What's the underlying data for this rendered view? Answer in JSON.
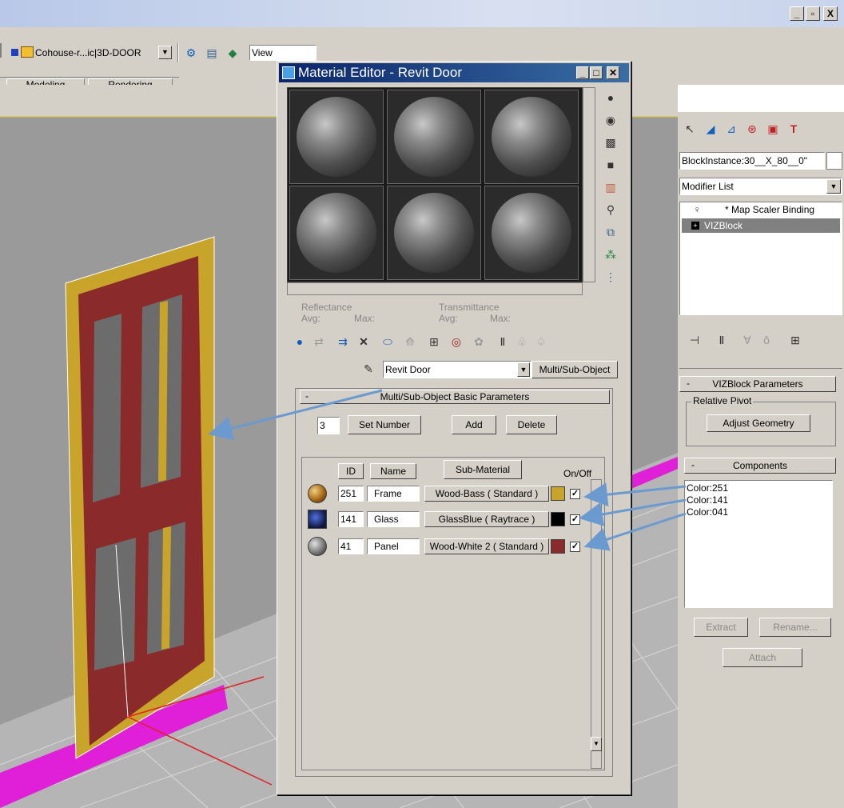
{
  "app": {
    "window_controls": [
      "_",
      "▫",
      "X"
    ],
    "toolbar": {
      "file_label": "Cohouse-r...ic|3D-DOOR",
      "view_label": "View"
    },
    "tabs": [
      {
        "label": "Modeling"
      },
      {
        "label": "Rendering"
      }
    ]
  },
  "material_editor": {
    "title": "Material Editor - Revit Door",
    "reflectance_label": "Reflectance",
    "transmittance_label": "Transmittance",
    "avg_label": "Avg:",
    "max_label": "Max:",
    "material_name": "Revit Door",
    "material_type": "Multi/Sub-Object",
    "rollout_title": "Multi/Sub-Object Basic Parameters",
    "set_number_value": "3",
    "set_number_label": "Set Number",
    "add_label": "Add",
    "delete_label": "Delete",
    "table_headers": {
      "id": "ID",
      "name": "Name",
      "sub_material": "Sub-Material",
      "on_off": "On/Off"
    },
    "rows": [
      {
        "id": "251",
        "name": "Frame",
        "sub_material": "Wood-Bass  ( Standard )",
        "color": "#c9a42a",
        "on": "✓"
      },
      {
        "id": "141",
        "name": "Glass",
        "sub_material": "GlassBlue  ( Raytrace )",
        "color": "#000000",
        "on": "✓"
      },
      {
        "id": "41",
        "name": "Panel",
        "sub_material": "Wood-White 2  ( Standard )",
        "color": "#8b2a2a",
        "on": "✓"
      }
    ]
  },
  "command_panel": {
    "object_name": "BlockInstance:30__X_80__0\"",
    "modifier_list": "Modifier List",
    "stack": [
      {
        "label": "* Map Scaler Binding"
      },
      {
        "label": "VIZBlock"
      }
    ],
    "vizblock_title": "VIZBlock Parameters",
    "relative_pivot": "Relative Pivot",
    "adjust_geometry": "Adjust Geometry",
    "components_title": "Components",
    "components": [
      "Color:251",
      "Color:141",
      "Color:041"
    ],
    "extract_label": "Extract",
    "rename_label": "Rename...",
    "attach_label": "Attach"
  },
  "colors": {
    "accent": "#0a246a",
    "frame": "#c9a42a",
    "panel": "#8b2a2a",
    "magenta": "#e020d8"
  },
  "icons": [
    "sphere-icon",
    "checker-icon",
    "pick-icon",
    "pin-icon",
    "arrow-icon"
  ]
}
